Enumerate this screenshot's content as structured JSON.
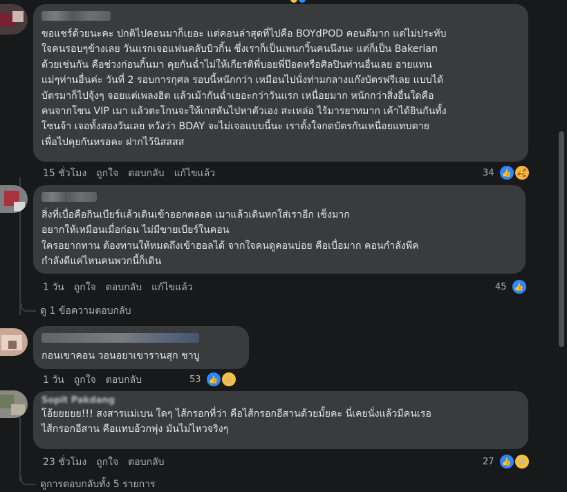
{
  "comments": [
    {
      "text": "ขอแชร์ด้วยนะคะ ปกติไปคอนมาก็เยอะ แต่คอนล่าสุดที่ไปคือ BOYdPOD คอนดีมาก แต่ไม่ประทับ\nใจคนรอบๆข้างเลย วันแรกเจอแฟนคลับบิวกิ้น ซึ่งเราก็เป็นเพนกวิ้นคนนึงนะ แต่ก็เป็น Bakerian\nด้วยเช่นกัน คือช่วงก่อนกิ้นมา คุยกันฉ่ำไม่ให้เกียรติพี่บอยพี่ป๊อดหรือศิลปินท่านอื่นเลย อายแทน\nแม่ๆท่านอื่นค่ะ วันที่ 2 รอบการกุศล รอบนี้หนักกว่า เหมือนไปนั่งท่ามกลางแก๊งบัตรฟรีเลย แบบได้\nบัตรมาก็ไปจุ้งๆ จอยแต่เพลงฮิต แล้วเม้ากันฉ่ำเยอะกว่าวันแรก เหนื่อยมาก หนักกว่าสิ่งอื่นใดคือ\nคนจากโซน VIP เมา แล้วตะโกนจะให้เกสหันไปหาตัวเอง สะเหล่อ ไร้มารยาทมาก เค้าได้ยินกันทั้ง\nโซนจ้า เจอทั้งสองวันเลย หวังว่า BDAY จะไม่เจอแบบนี้นะ เราตั้งใจกดบัตรกันเหนื่อยแทบตาย\nเพื่อไปคุยกันหรอคะ ฝากไว้นิสสสส",
      "time": "15 ชั่วโมง",
      "like": "ถูกใจ",
      "reply": "ตอบกลับ",
      "edited": "แก้ไขแล้ว",
      "count": "34",
      "reactions": [
        "like-icon",
        "love-icon"
      ]
    },
    {
      "text": "สิ่งที่เบื่อคือกินเบียร์แล้วเดินเข้าออกตลอด เมาแล้วเดินหกใส่เราอีก เซ็งมาก\nอยากให้เหมือนเมื่อก่อน ไม่มีขายเบียร์ในคอน\nใครอยากทาน ต้องทานให้หมดถึงเข้าฮอลได้ จากใจคนดูคอนบ่อย คือเบื่อมาก คอนกำลังพีค\nกำลังดีแค่ไหนคนพวกนี้ก็เดิน",
      "time": "1 วัน",
      "like": "ถูกใจ",
      "reply": "ตอบกลับ",
      "edited": "แก้ไขแล้ว",
      "count": "45",
      "reactions": [
        "like-icon"
      ],
      "view_replies": "ดู 1 ข้อความตอบกลับ"
    },
    {
      "text": "กอนเขาคอน วอนอยาเขารานสุก ชาบู",
      "time": "1 วัน",
      "like": "ถูกใจ",
      "reply": "ตอบกลับ",
      "count": "53",
      "reactions": [
        "like-icon",
        "haha-icon"
      ]
    },
    {
      "name": "Sopit Pakdang",
      "text": "โอ้ยยยยย!!! สงสารแม่เบน ใดๆ ไส้กรอกที่ว่า คือไส้กรอกอีสานด้วยมั้ยคะ นี่เคยนั่งแล้วมีคนเรอ\nไส้กรอกอีสาน คือแทบอ้วกพุ่ง มันไม่ไหวจริงๆ",
      "time": "23 ชั่วโมง",
      "like": "ถูกใจ",
      "reply": "ตอบกลับ",
      "count": "27",
      "reactions": [
        "like-icon",
        "haha-icon"
      ]
    }
  ],
  "view_all_replies": "ดูการตอบกลับทั้ง 5 รายการ",
  "colors": {
    "bg": "#18191a",
    "bubble": "#3a3b3c",
    "text": "#e4e6eb",
    "muted": "#b0b3b8",
    "like": "#2d88ff"
  }
}
